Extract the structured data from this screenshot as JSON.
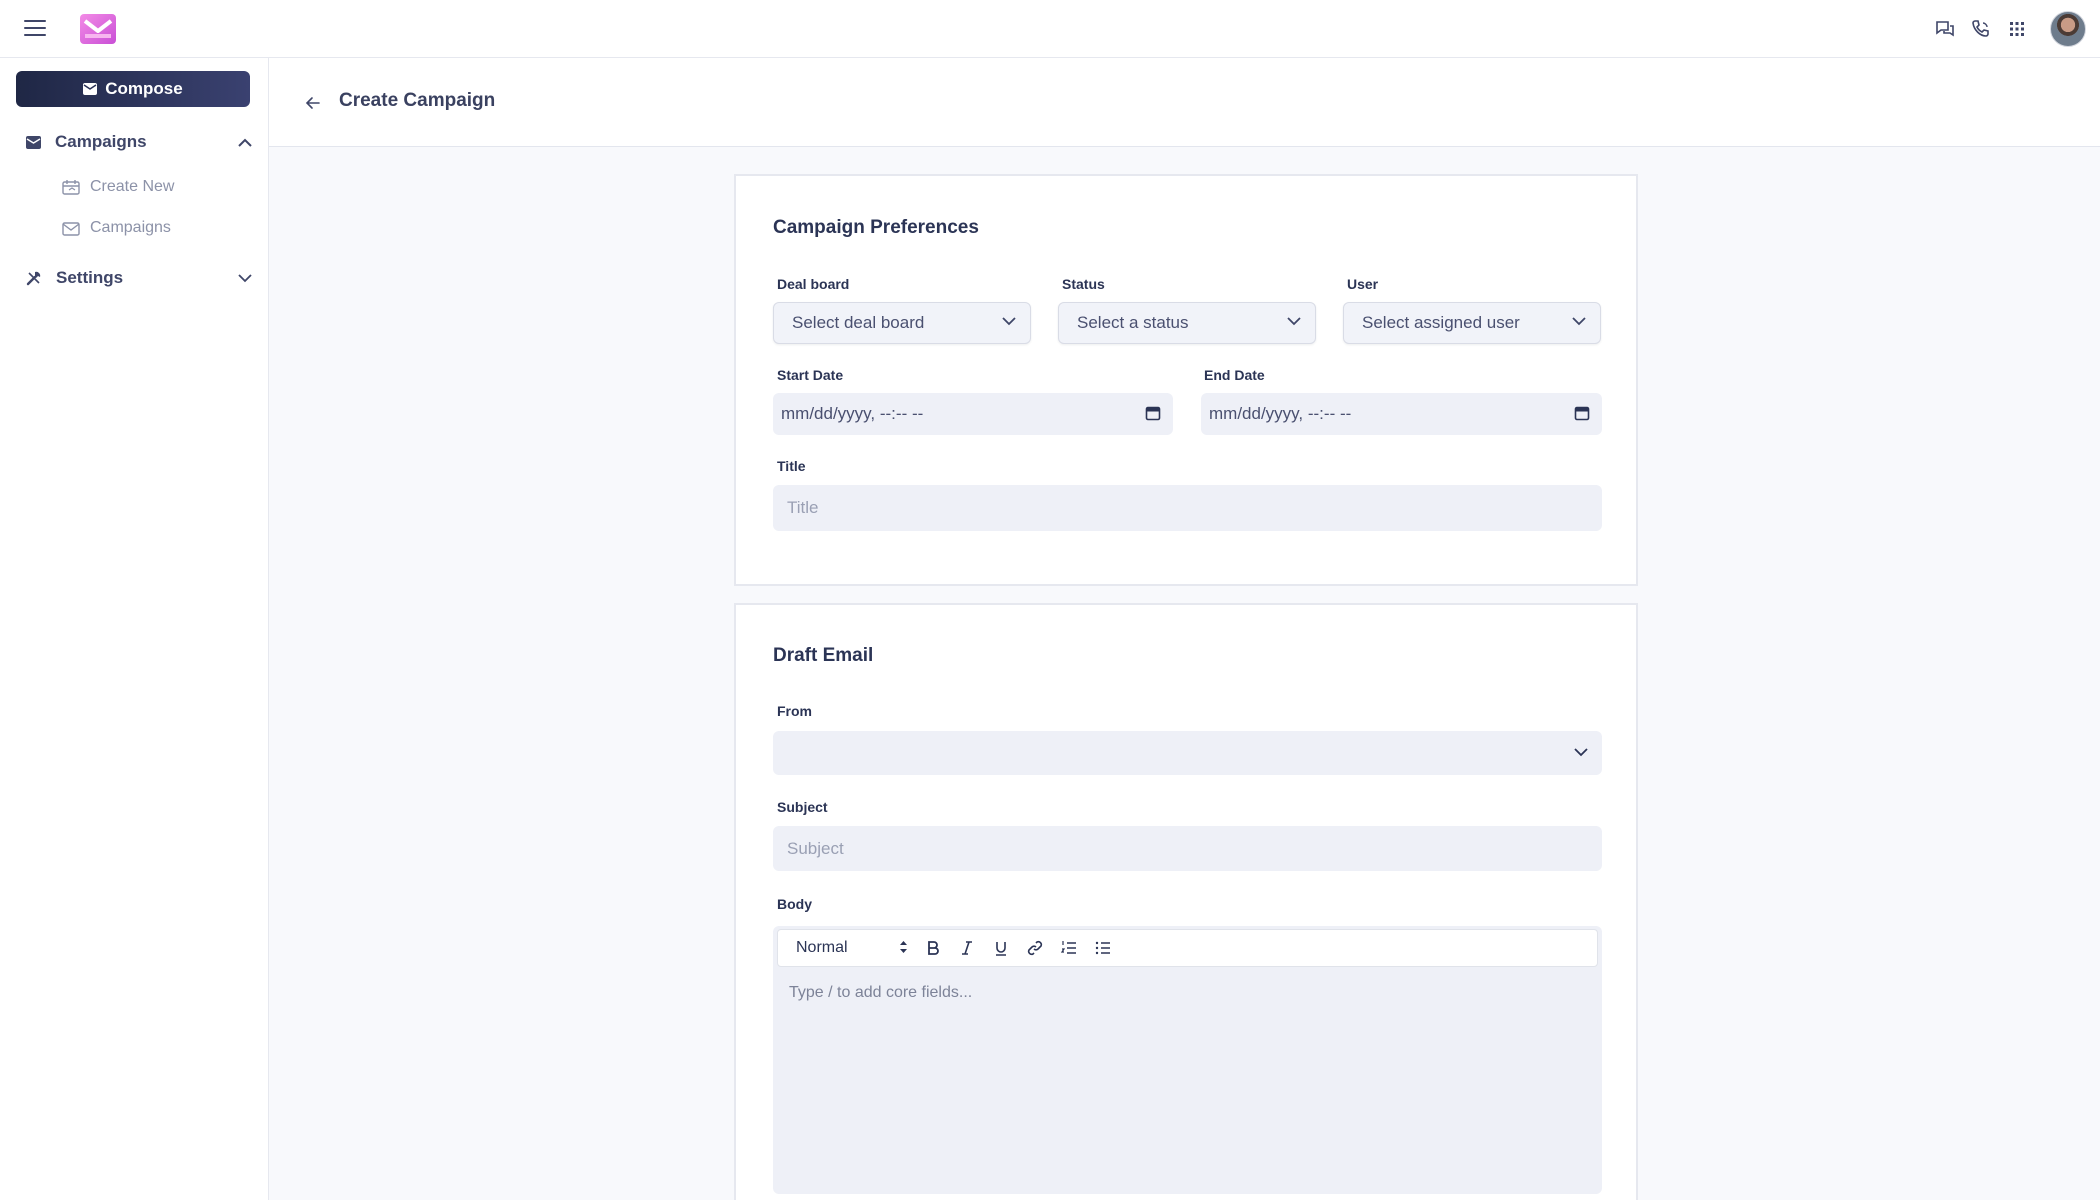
{
  "header": {
    "menu_icon": "hamburger-icon",
    "logo_icon": "mail-logo-icon",
    "icons": [
      "chat-icon",
      "phone-icon",
      "apps-grid-icon"
    ],
    "avatar": "user-avatar"
  },
  "sidebar": {
    "compose_label": "Compose",
    "groups": [
      {
        "label": "Campaigns",
        "icon": "envelope-icon",
        "expanded": true,
        "items": [
          {
            "label": "Create New",
            "icon": "calendar-mail-icon"
          },
          {
            "label": "Campaigns",
            "icon": "mail-list-icon"
          }
        ]
      },
      {
        "label": "Settings",
        "icon": "tools-icon",
        "expanded": false
      }
    ]
  },
  "page": {
    "title": "Create Campaign"
  },
  "preferences": {
    "title": "Campaign Preferences",
    "deal_board_label": "Deal board",
    "deal_board_value": "Select deal board",
    "status_label": "Status",
    "status_value": "Select a status",
    "user_label": "User",
    "user_value": "Select assigned user",
    "start_date_label": "Start Date",
    "start_date_value": "mm/dd/yyyy, --:-- --",
    "end_date_label": "End Date",
    "end_date_value": "mm/dd/yyyy, --:-- --",
    "title_label": "Title",
    "title_placeholder": "Title"
  },
  "draft": {
    "title": "Draft Email",
    "from_label": "From",
    "from_value": "",
    "subject_label": "Subject",
    "subject_placeholder": "Subject",
    "body_label": "Body",
    "format_value": "Normal",
    "body_placeholder": "Type / to add core fields..."
  },
  "colors": {
    "compose_gradient_start": "#1f2745",
    "compose_gradient_end": "#3a4170",
    "logo_pink": "#e56ad8"
  }
}
